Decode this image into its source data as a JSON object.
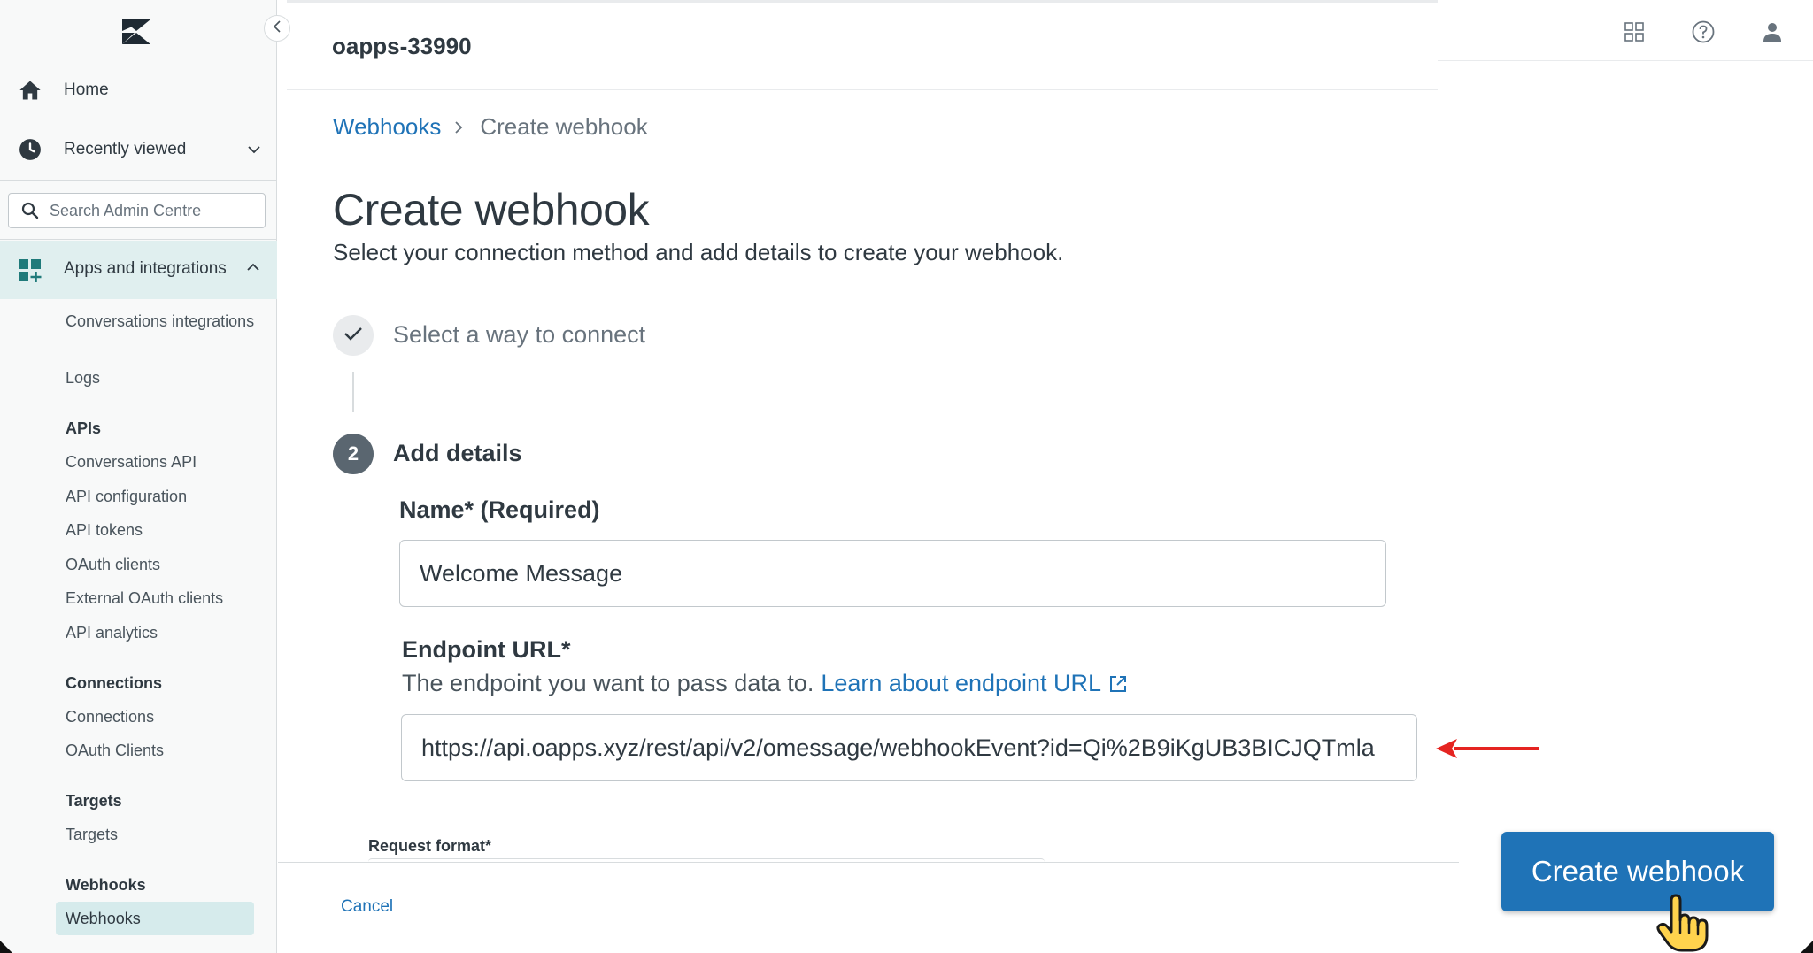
{
  "sidebar": {
    "home_label": "Home",
    "recent_label": "Recently viewed",
    "search_placeholder": "Search Admin Centre",
    "apps_label": "Apps and integrations",
    "items": {
      "conversations_integrations": "Conversations integrations",
      "logs": "Logs",
      "apis_heading": "APIs",
      "conversations_api": "Conversations API",
      "api_configuration": "API configuration",
      "api_tokens": "API tokens",
      "oauth_clients": "OAuth clients",
      "external_oauth_clients": "External OAuth clients",
      "api_analytics": "API analytics",
      "connections_heading": "Connections",
      "connections": "Connections",
      "oauth_clients_conn": "OAuth Clients",
      "targets_heading": "Targets",
      "targets": "Targets",
      "webhooks_heading": "Webhooks",
      "webhooks": "Webhooks"
    }
  },
  "header": {
    "account": "oapps-33990"
  },
  "breadcrumb": {
    "parent": "Webhooks",
    "current": "Create webhook"
  },
  "page": {
    "title": "Create webhook",
    "subtitle": "Select your connection method and add details to create your webhook."
  },
  "steps": {
    "step1_label": "Select a way to connect",
    "step2_number": "2",
    "step2_label": "Add details"
  },
  "form": {
    "name_label": "Name* (Required)",
    "name_value": "Welcome Message",
    "url_label": "Endpoint URL*",
    "url_hint": "The endpoint you want to pass data to.",
    "url_link": "Learn about endpoint URL",
    "url_value": "https://api.oapps.xyz/rest/api/v2/omessage/webhookEvent?id=Qi%2B9iKgUB3BICJQTmla",
    "request_format_label": "Request format*"
  },
  "footer": {
    "cancel": "Cancel",
    "create": "Create webhook"
  },
  "colors": {
    "accent": "#1f73b7",
    "sidebar_active": "#e0efef",
    "arrow": "#e52421"
  }
}
